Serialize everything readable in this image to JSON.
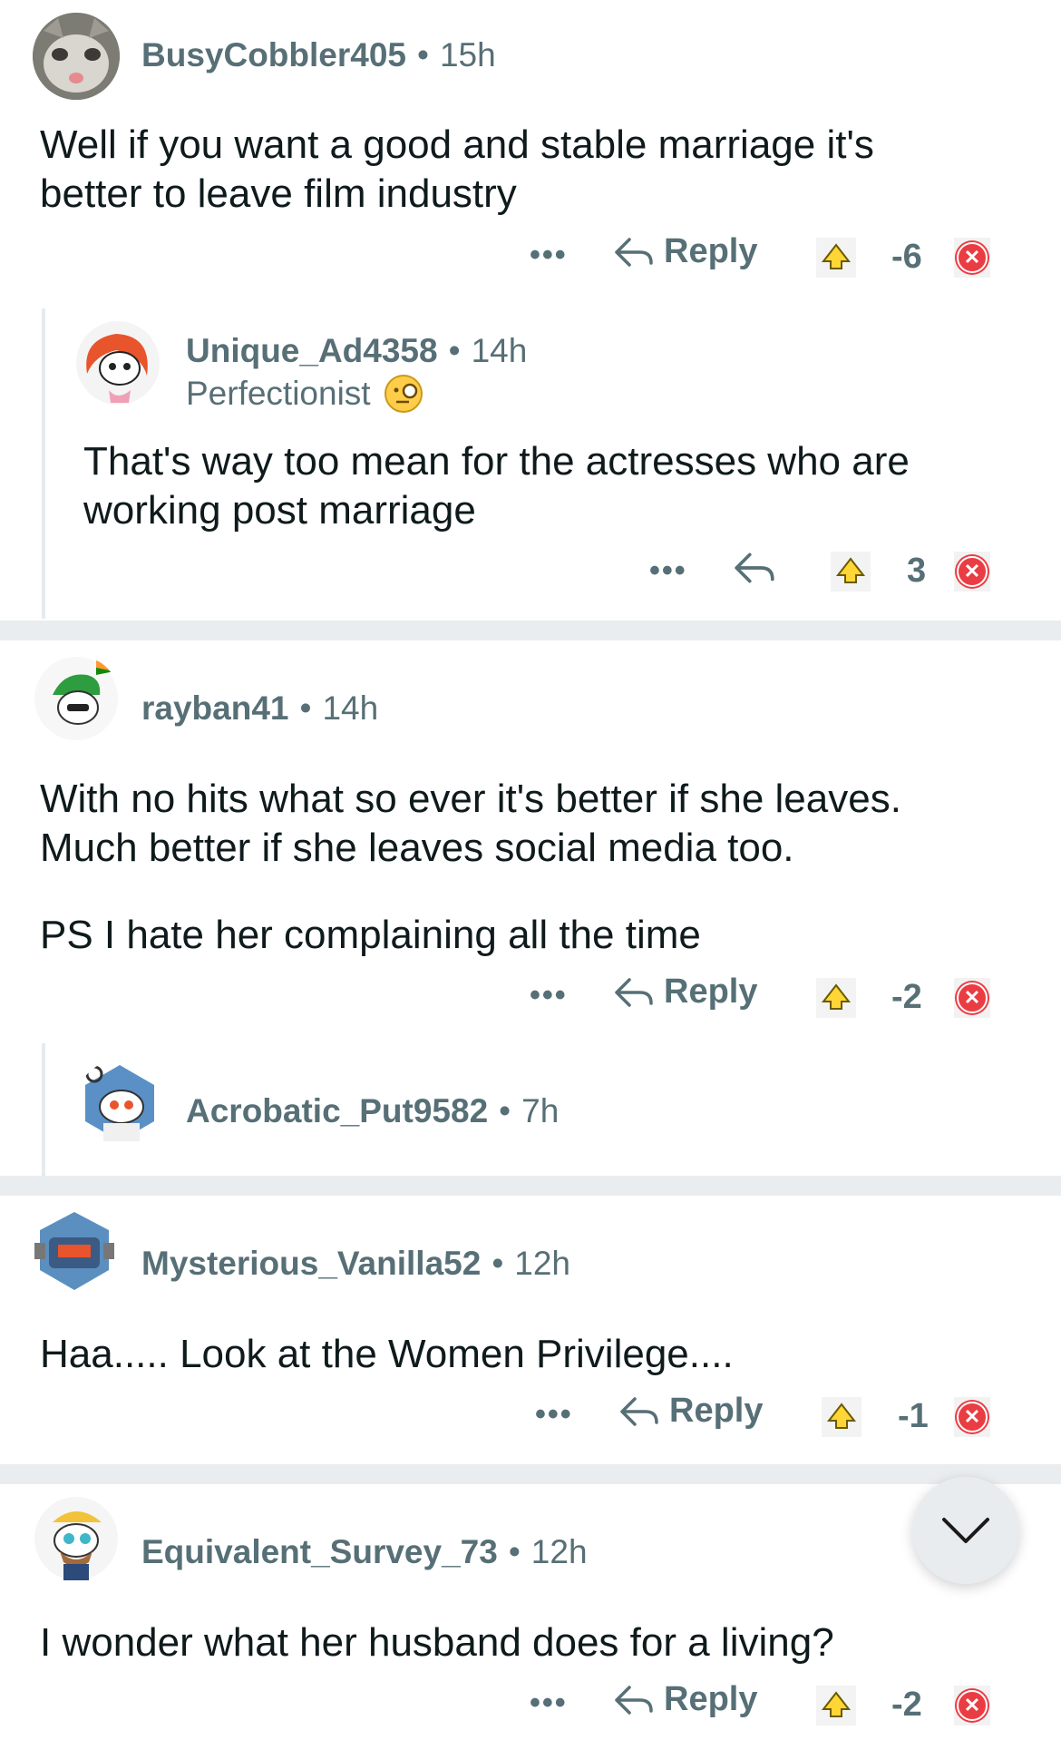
{
  "comments": [
    {
      "user": "BusyCobbler405",
      "time": "15h",
      "flair": "",
      "text": "Well if you want a good and stable marriage it's better to leave film industry",
      "reply_label": "Reply",
      "score": "-6"
    },
    {
      "user": "Unique_Ad4358",
      "time": "14h",
      "flair": "Perfectionist",
      "text": "That's way too mean for the actresses who are working post marriage",
      "reply_label": "",
      "score": "3"
    },
    {
      "user": "rayban41",
      "time": "14h",
      "flair": "",
      "text": "With no hits what so ever it's better if she leaves. Much better if she leaves social media too.",
      "text2": "PS I hate her complaining all the time",
      "reply_label": "Reply",
      "score": "-2"
    },
    {
      "user": "Acrobatic_Put9582",
      "time": "7h",
      "flair": "",
      "text": ""
    },
    {
      "user": "Mysterious_Vanilla52",
      "time": "12h",
      "flair": "",
      "text": "Haa..... Look at the Women Privilege....",
      "reply_label": "Reply",
      "score": "-1"
    },
    {
      "user": "Equivalent_Survey_73",
      "time": "12h",
      "flair": "",
      "text": "I wonder what her husband does for a living?",
      "reply_label": "Reply",
      "score": "-2"
    }
  ],
  "icons": {
    "more": "more-icon",
    "reply": "reply-arrow-icon",
    "upvote": "upvote-icon",
    "downvote": "downvote-icon",
    "scroll": "chevron-down-icon"
  },
  "colors": {
    "username": "#576f76",
    "body": "#0f1a1c",
    "downvote": "#ea3d43",
    "upvote": "#ffd635",
    "separator": "#eaedef"
  }
}
